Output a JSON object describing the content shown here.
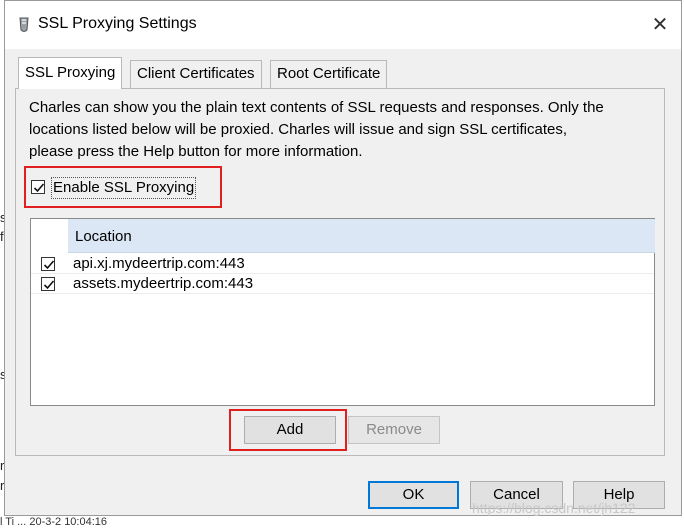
{
  "window": {
    "title": "SSL Proxying Settings",
    "close_symbol": "✕",
    "icon": "charles-app-icon"
  },
  "tabs": [
    {
      "label": "SSL Proxying",
      "active": true
    },
    {
      "label": "Client Certificates",
      "active": false
    },
    {
      "label": "Root Certificate",
      "active": false
    }
  ],
  "description": {
    "line1": "Charles can show you the plain text contents of SSL requests and responses. Only the",
    "line2": "locations listed below will be proxied. Charles will issue and sign SSL certificates,",
    "line3": "please press the Help button for more information."
  },
  "enable_ssl": {
    "label": "Enable SSL Proxying",
    "checked": true
  },
  "locations": {
    "header": "Location",
    "rows": [
      {
        "location": "api.xj.mydeertrip.com:443",
        "checked": true
      },
      {
        "location": "assets.mydeertrip.com:443",
        "checked": true
      }
    ]
  },
  "buttons": {
    "add": "Add",
    "remove": "Remove",
    "ok": "OK",
    "cancel": "Cancel",
    "help": "Help"
  },
  "background": {
    "bottom_fragment": "l Ti ... 20-3-2 10:04:16",
    "frag1": "s",
    "frag2": "f",
    "frag3": "s",
    "frag4": "r",
    "frag5": "r"
  },
  "watermark": "https://blog.csdn.net/jh122",
  "colors": {
    "highlight": "#e02020",
    "header_bg": "#dbe7f4",
    "default_button_border": "#0078d7"
  }
}
